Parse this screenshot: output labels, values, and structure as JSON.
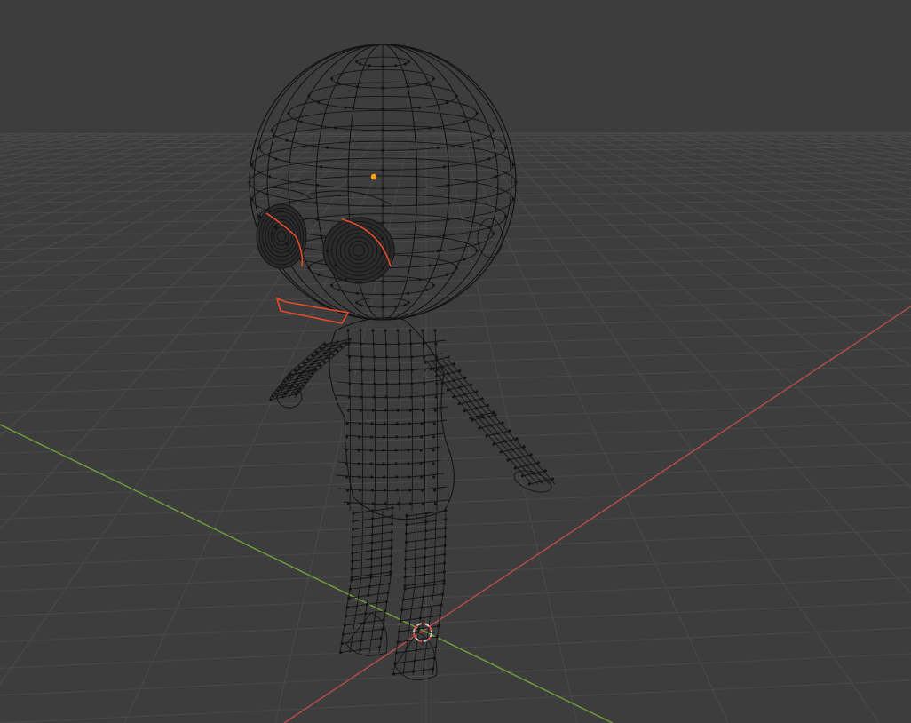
{
  "app": {
    "viewport_mode": "edit-mode-wireframe",
    "background_color": "#3d3d3d",
    "grid_color": "#4a4a4a",
    "x_axis_color": "#b34b4b",
    "y_axis_color": "#6f9a3a",
    "wire_color": "#141414",
    "selected_edge_color": "#e8492b",
    "origin_color": "#ff9f1a",
    "cursor_color": "#c9c9c9",
    "cursor_accent_color": "#d94c4c"
  },
  "scene": {
    "object_type": "mesh",
    "object_shape": "chibi-character",
    "selection_state": "partial",
    "icons": {
      "object_origin": "origin-dot-icon",
      "3d_cursor": "3d-cursor-icon"
    }
  }
}
